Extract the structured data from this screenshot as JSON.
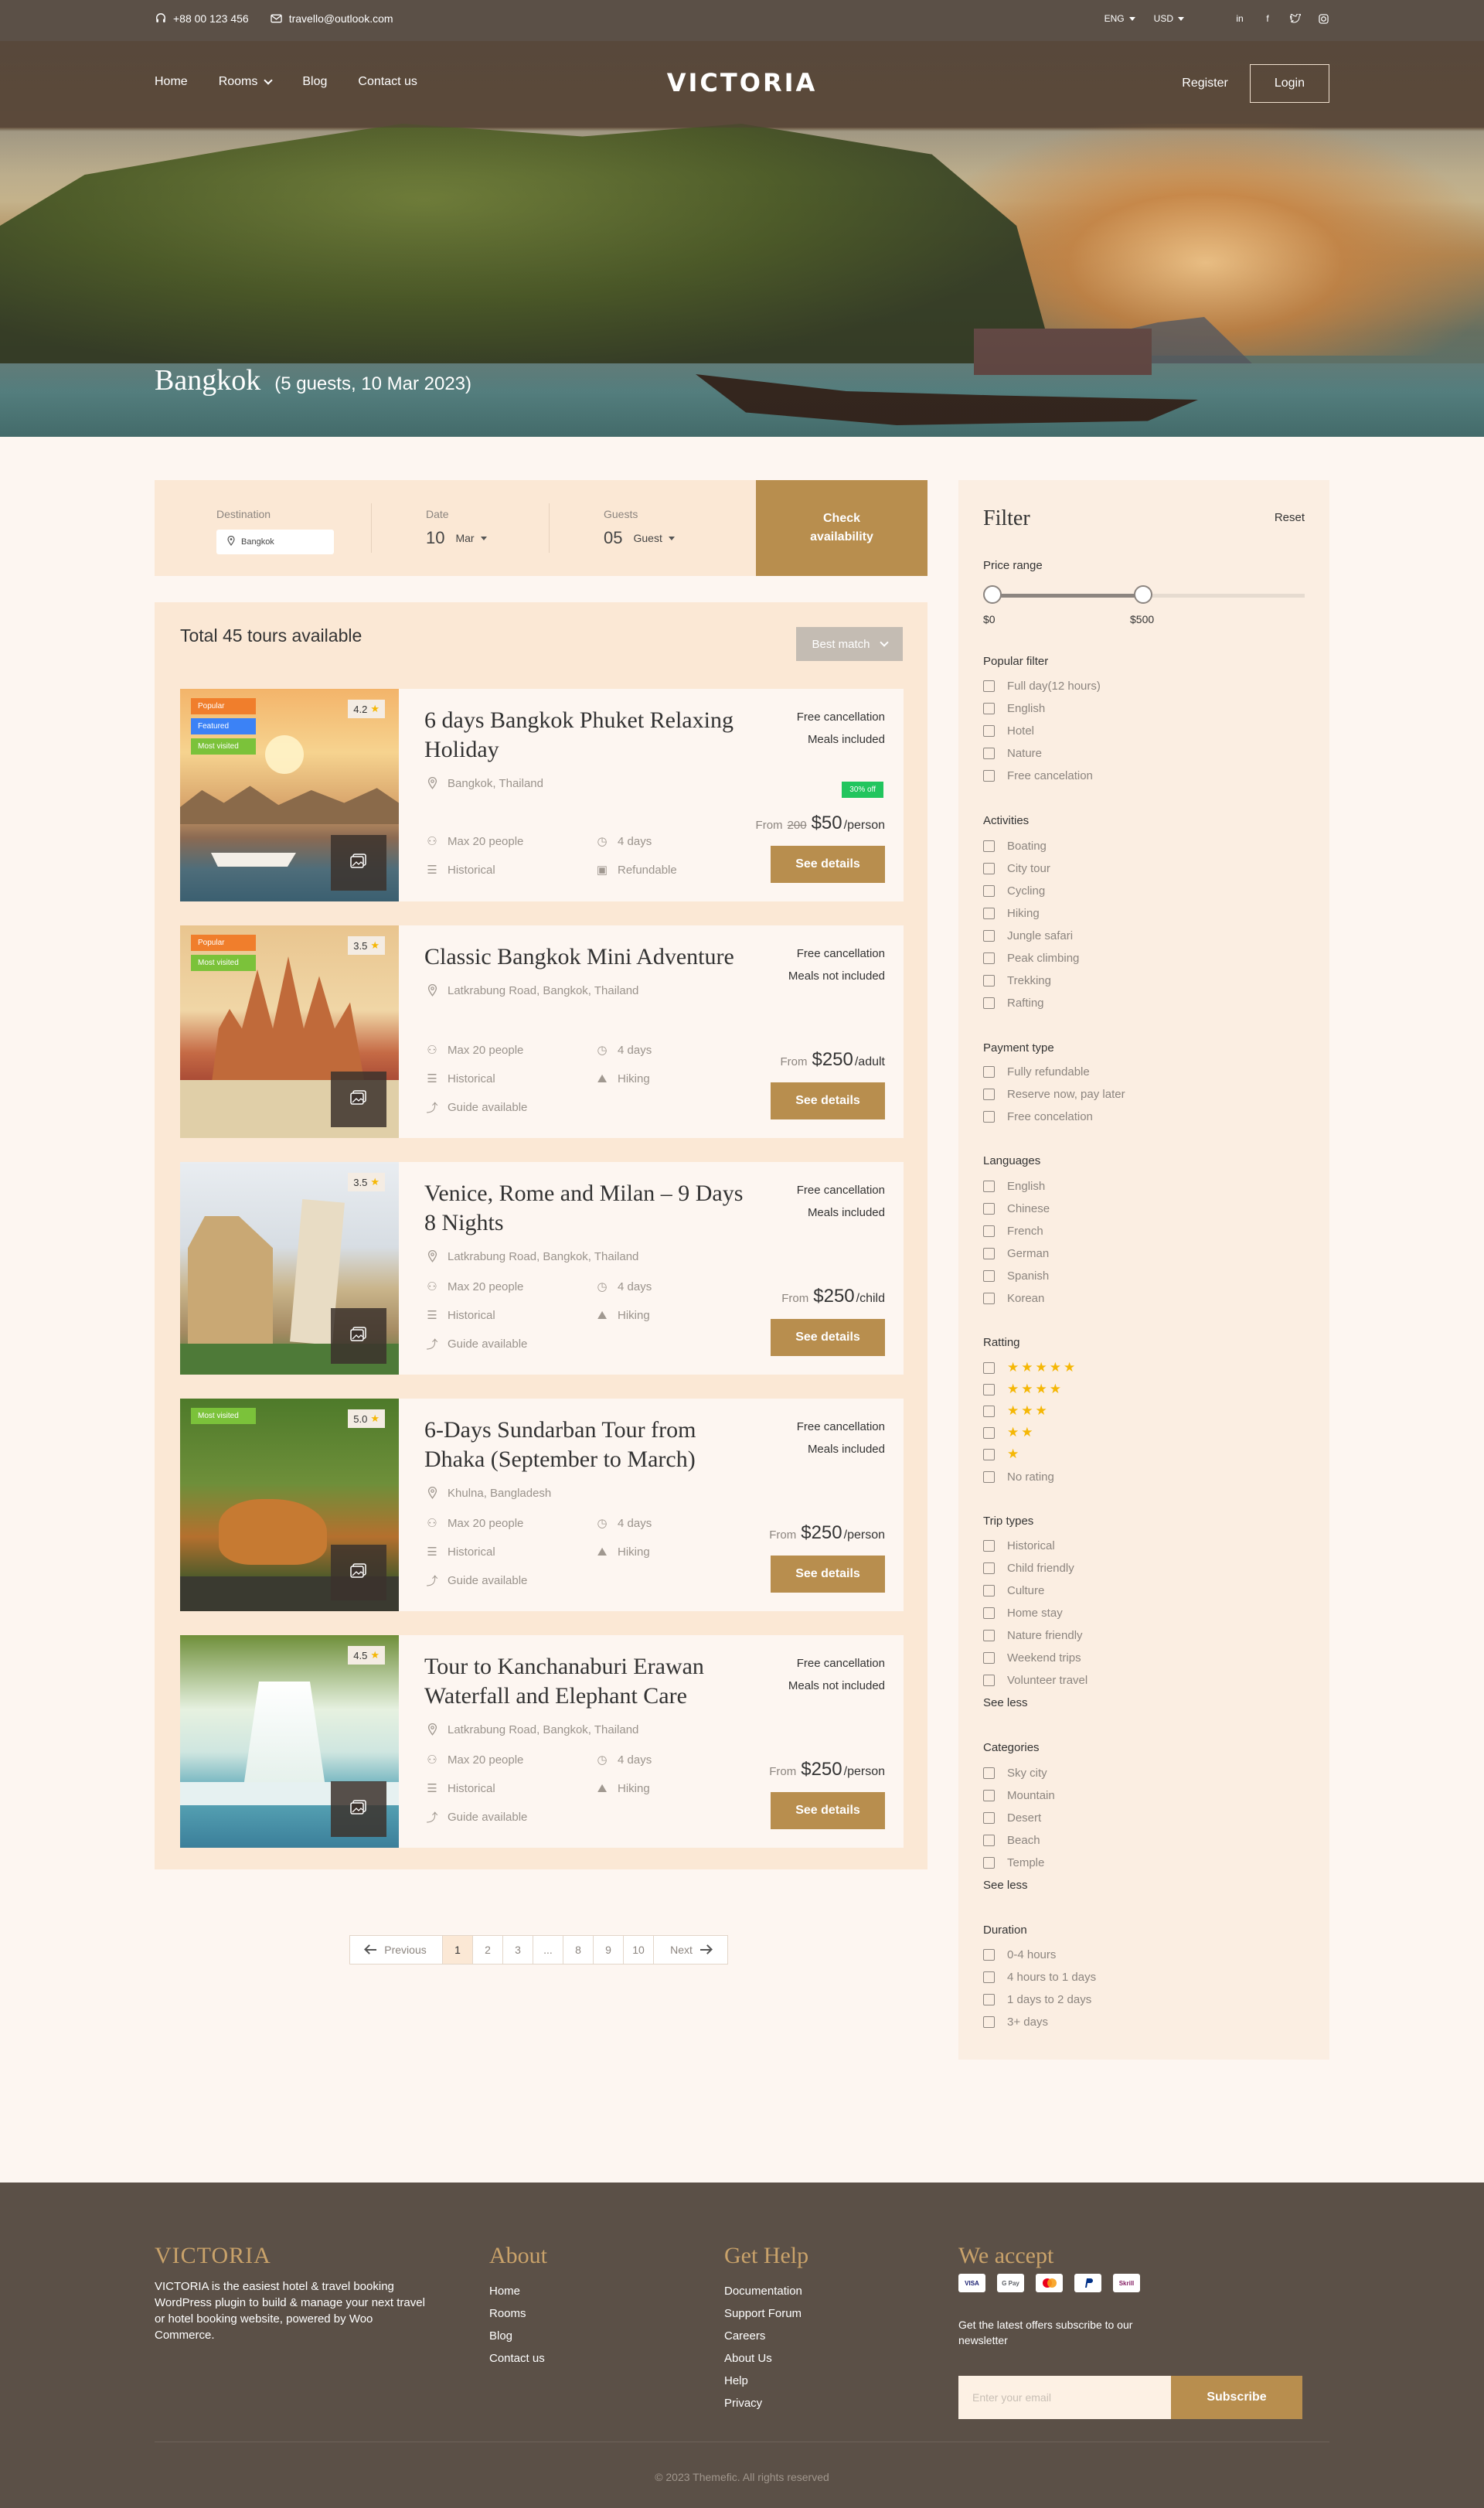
{
  "topbar": {
    "phone": "+88 00 123 456",
    "email": "travello@outlook.com",
    "language": "ENG",
    "currency": "USD",
    "social_icons": [
      "linkedin-icon",
      "facebook-icon",
      "twitter-icon",
      "instagram-icon"
    ]
  },
  "nav": {
    "home": "Home",
    "rooms": "Rooms",
    "blog": "Blog",
    "contact": "Contact us",
    "logo": "VICTORIA",
    "register": "Register",
    "login": "Login"
  },
  "hero": {
    "city": "Bangkok",
    "meta": "(5 guests, 10 Mar 2023)"
  },
  "search": {
    "destination_label": "Destination",
    "destination_value": "Bangkok",
    "date_label": "Date",
    "date_day": "10",
    "date_month": "Mar",
    "guests_label": "Guests",
    "guests_count": "05",
    "guests_unit": "Guest",
    "check_button": "Check availability"
  },
  "results": {
    "total": "Total 45 tours available",
    "sort": "Best match",
    "cards": [
      {
        "title": "6 days Bangkok Phuket Relaxing Holiday",
        "location": "Bangkok, Thailand",
        "badges": [
          "Popular",
          "Featured",
          "Most visited"
        ],
        "rating": "4.2",
        "f1": "Max 20 people",
        "f2": "4 days",
        "f3": "Historical",
        "f4": "Refundable",
        "f5": "",
        "cancel": "Free cancellation",
        "meals": "Meals included",
        "discount": "30% off",
        "from": "From",
        "old": "200",
        "price": "$50",
        "unit": "/person",
        "details": "See details"
      },
      {
        "title": "Classic Bangkok Mini Adventure",
        "location": "Latkrabung Road, Bangkok, Thailand",
        "badges": [
          "Popular",
          "Most visited"
        ],
        "rating": "3.5",
        "f1": "Max 20 people",
        "f2": "4 days",
        "f3": "Historical",
        "f4": "Hiking",
        "f5": "Guide available",
        "cancel": "Free cancellation",
        "meals": "Meals not included",
        "from": "From",
        "price": "$250",
        "unit": "/adult",
        "details": "See details"
      },
      {
        "title": "Venice, Rome and Milan – 9 Days 8 Nights",
        "location": "Latkrabung Road, Bangkok, Thailand",
        "badges": [],
        "rating": "3.5",
        "f1": "Max 20 people",
        "f2": "4 days",
        "f3": "Historical",
        "f4": "Hiking",
        "f5": "Guide available",
        "cancel": "Free cancellation",
        "meals": "Meals included",
        "from": "From",
        "price": "$250",
        "unit": "/child",
        "details": "See details"
      },
      {
        "title": "6-Days Sundarban Tour from Dhaka (September to March)",
        "location": "Khulna, Bangladesh",
        "badges": [
          "Most visited"
        ],
        "rating": "5.0",
        "f1": "Max 20 people",
        "f2": "4 days",
        "f3": "Historical",
        "f4": "Hiking",
        "f5": "Guide available",
        "cancel": "Free cancellation",
        "meals": "Meals included",
        "from": "From",
        "price": "$250",
        "unit": "/person",
        "details": "See details"
      },
      {
        "title": "Tour to Kanchanaburi Erawan Waterfall and Elephant Care",
        "location": "Latkrabung Road, Bangkok, Thailand",
        "badges": [],
        "rating": "4.5",
        "f1": "Max 20 people",
        "f2": "4 days",
        "f3": "Historical",
        "f4": "Hiking",
        "f5": "Guide available",
        "cancel": "Free cancellation",
        "meals": "Meals not included",
        "from": "From",
        "price": "$250",
        "unit": "/person",
        "details": "See details"
      }
    ]
  },
  "pagination": {
    "prev": "Previous",
    "next": "Next",
    "pages": [
      "1",
      "2",
      "3",
      "...",
      "8",
      "9",
      "10"
    ],
    "current": "1"
  },
  "filter": {
    "title": "Filter",
    "reset": "Reset",
    "price_title": "Price range",
    "price_min": "$0",
    "price_max": "$500",
    "popular_title": "Popular filter",
    "popular": [
      "Full day(12 hours)",
      "English",
      "Hotel",
      "Nature",
      "Free cancelation"
    ],
    "activities_title": "Activities",
    "activities": [
      "Boating",
      "City tour",
      "Cycling",
      "Hiking",
      "Jungle safari",
      "Peak climbing",
      "Trekking",
      "Rafting"
    ],
    "payment_title": "Payment type",
    "payment": [
      "Fully refundable",
      "Reserve now, pay later",
      "Free concelation"
    ],
    "languages_title": "Languages",
    "languages": [
      "English",
      "Chinese",
      "French",
      "German",
      "Spanish",
      "Korean"
    ],
    "rating_title": "Ratting",
    "ratings": [
      "★★★★★",
      "★★★★",
      "★★★",
      "★★",
      "★"
    ],
    "no_rating": "No rating",
    "trip_title": "Trip types",
    "trips": [
      "Historical",
      "Child friendly",
      "Culture",
      "Home stay",
      "Nature friendly",
      "Weekend trips",
      "Volunteer travel"
    ],
    "see_less": "See less",
    "categories_title": "Categories",
    "categories": [
      "Sky city",
      "Mountain",
      "Desert",
      "Beach",
      "Temple"
    ],
    "duration_title": "Duration",
    "durations": [
      "0-4 hours",
      "4 hours to 1 days",
      "1 days to 2 days",
      "3+ days"
    ]
  },
  "footer": {
    "brand": "VICTORIA",
    "description": "VICTORIA is the easiest hotel & travel booking WordPress plugin to build & manage your next travel or hotel booking website, powered by Woo Commerce.",
    "about_title": "About",
    "about": [
      "Home",
      "Rooms",
      "Blog",
      "Contact us"
    ],
    "help_title": "Get Help",
    "help": [
      "Documentation",
      "Support Forum",
      "Careers",
      "About Us",
      "Help",
      "Privacy"
    ],
    "accept_title": "We accept",
    "payments": [
      "VISA",
      "G Pay",
      "mastercard-icon",
      "paypal-icon",
      "Skrill"
    ],
    "newsletter": "Get the latest offers subscribe to our newsletter",
    "email_placeholder": "Enter your email",
    "subscribe": "Subscribe",
    "copyright": "© 2023 Themefic. All rights reserved"
  }
}
